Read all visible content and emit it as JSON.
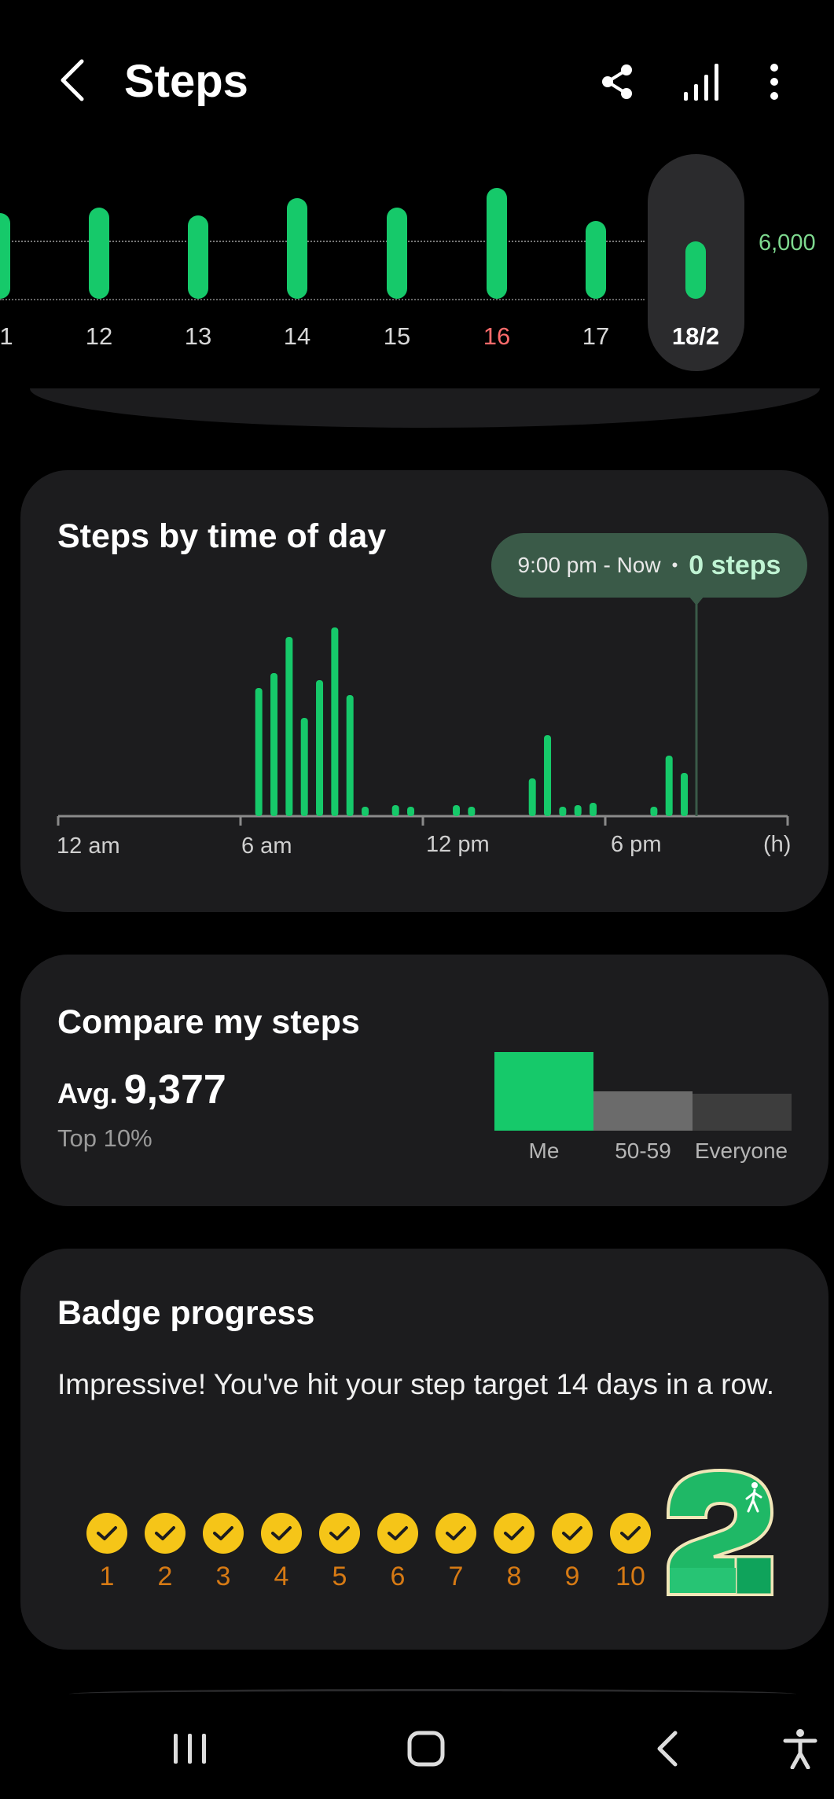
{
  "header": {
    "title": "Steps",
    "back_icon": "chevron-left-icon",
    "share_icon": "share-icon",
    "chart_icon": "signal-bars-icon",
    "more_icon": "more-vertical-icon"
  },
  "daily_chart": {
    "days": [
      {
        "label": "1",
        "steps_fraction": 0.75,
        "highlight": false,
        "selected": false
      },
      {
        "label": "12",
        "steps_fraction": 0.8,
        "highlight": false,
        "selected": false
      },
      {
        "label": "13",
        "steps_fraction": 0.73,
        "highlight": false,
        "selected": false
      },
      {
        "label": "14",
        "steps_fraction": 0.88,
        "highlight": false,
        "selected": false
      },
      {
        "label": "15",
        "steps_fraction": 0.8,
        "highlight": false,
        "selected": false
      },
      {
        "label": "16",
        "steps_fraction": 0.97,
        "highlight": true,
        "selected": false
      },
      {
        "label": "17",
        "steps_fraction": 0.68,
        "highlight": false,
        "selected": false
      },
      {
        "label": "18/2",
        "steps_fraction": 0.5,
        "highlight": false,
        "selected": true
      }
    ],
    "target_label": "6,000",
    "colors": {
      "bar": "#16c96a",
      "weekend": "#ff6b6b",
      "target": "#7ed98f"
    }
  },
  "steps_by_time": {
    "title": "Steps by time of day",
    "tooltip_time": "9:00 pm - Now",
    "tooltip_steps": "0 steps",
    "x_labels": [
      "12 am",
      "6 am",
      "12 pm",
      "6 pm",
      "(h)"
    ],
    "chart_data": {
      "type": "bar",
      "xlabel": "(h)",
      "bars": [
        {
          "hour": 6.6,
          "value": 0.68
        },
        {
          "hour": 7.1,
          "value": 0.76
        },
        {
          "hour": 7.6,
          "value": 0.95
        },
        {
          "hour": 8.1,
          "value": 0.52
        },
        {
          "hour": 8.6,
          "value": 0.72
        },
        {
          "hour": 9.1,
          "value": 1.0
        },
        {
          "hour": 9.6,
          "value": 0.64
        },
        {
          "hour": 10.1,
          "value": 0.05
        },
        {
          "hour": 11.1,
          "value": 0.06
        },
        {
          "hour": 11.6,
          "value": 0.05
        },
        {
          "hour": 13.1,
          "value": 0.06
        },
        {
          "hour": 13.6,
          "value": 0.05
        },
        {
          "hour": 15.6,
          "value": 0.2
        },
        {
          "hour": 16.1,
          "value": 0.43
        },
        {
          "hour": 16.6,
          "value": 0.05
        },
        {
          "hour": 17.1,
          "value": 0.06
        },
        {
          "hour": 17.6,
          "value": 0.07
        },
        {
          "hour": 19.6,
          "value": 0.05
        },
        {
          "hour": 20.1,
          "value": 0.32
        },
        {
          "hour": 20.6,
          "value": 0.23
        }
      ],
      "marker_hour": 21.0
    }
  },
  "compare": {
    "title": "Compare my steps",
    "avg_prefix": "Avg.",
    "avg_value": "9,377",
    "rank": "Top 10%",
    "groups": [
      {
        "label": "Me",
        "level": 1.0,
        "color": "#16c96a"
      },
      {
        "label": "50-59",
        "level": 0.5,
        "color": "#6b6b6b"
      },
      {
        "label": "Everyone",
        "level": 0.47,
        "color": "#3d3d3d"
      }
    ]
  },
  "badge": {
    "title": "Badge progress",
    "message": "Impressive! You've hit your step target 14 days in a row.",
    "days": [
      "1",
      "2",
      "3",
      "4",
      "5",
      "6",
      "7",
      "8",
      "9",
      "10"
    ],
    "badge_icon": "streak-badge-icon",
    "badge_number": "2"
  },
  "navbar": {
    "recents_icon": "recents-icon",
    "home_icon": "home-icon",
    "back_icon": "back-icon",
    "accessibility_icon": "accessibility-icon"
  }
}
